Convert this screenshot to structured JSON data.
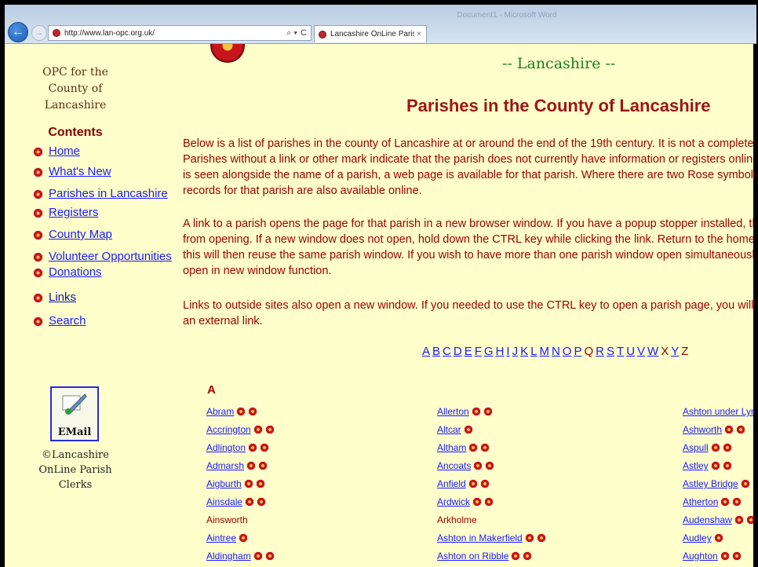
{
  "browser": {
    "window_title_ghost": "Document1 - Microsoft Word",
    "address": "http://www.lan-opc.org.uk/",
    "address_tools": [
      "⌕ ▾",
      "C"
    ],
    "tab_title": "Lancashire OnLine Parish Cl...",
    "tab_close": "×"
  },
  "sidebar": {
    "brand_lines": [
      "OPC for the",
      "County of",
      "Lancashire"
    ],
    "contents_heading": "Contents",
    "nav": [
      {
        "label": "Home"
      },
      {
        "label": "What's New"
      },
      {
        "label": "Parishes in Lancashire"
      },
      {
        "label": "Registers"
      },
      {
        "label": "County Map"
      },
      {
        "label": "Volunteer Opportunities"
      },
      {
        "label": "Donations"
      },
      {
        "label": "Links"
      },
      {
        "label": "Search"
      }
    ],
    "email_label": "EMail",
    "copyright_lines": [
      "©Lancashire",
      "OnLine Parish",
      "Clerks"
    ]
  },
  "main": {
    "county_title": "-- Lancashire --",
    "heading": "Parishes in the County of Lancashire",
    "paragraphs": [
      [
        "Below is a list of parishes in the county of Lancashire at or around the end of the 19th century. It is not a complete l",
        "Parishes without a link or other mark indicate that the parish does not currently have information or registers online.",
        "is seen alongside the name of a parish, a web page is available for that parish. Where there are two Rose symbols,",
        "records for that parish are also available online."
      ],
      [
        "A link to a parish opens the page for that parish in a new browser window. If you have a popup stopper installed, thi",
        "from opening. If a new window does not open, hold down the CTRL key while clicking the link. Return to the home v",
        "this will then reuse the same parish window. If you wish to have more than one parish window open simultaneously",
        "open in new window function."
      ],
      [
        "Links to outside sites also open a new window. If you needed to use the CTRL key to open a parish page, you will a",
        "an external link."
      ]
    ],
    "alphabet": [
      {
        "l": "A",
        "link": true
      },
      {
        "l": "B",
        "link": true
      },
      {
        "l": "C",
        "link": true
      },
      {
        "l": "D",
        "link": true
      },
      {
        "l": "E",
        "link": true
      },
      {
        "l": "F",
        "link": true
      },
      {
        "l": "G",
        "link": true
      },
      {
        "l": "H",
        "link": true
      },
      {
        "l": "I",
        "link": true
      },
      {
        "l": "J",
        "link": true
      },
      {
        "l": "K",
        "link": true
      },
      {
        "l": "L",
        "link": true
      },
      {
        "l": "M",
        "link": true
      },
      {
        "l": "N",
        "link": true
      },
      {
        "l": "O",
        "link": true
      },
      {
        "l": "P",
        "link": true
      },
      {
        "l": "Q",
        "link": false
      },
      {
        "l": "R",
        "link": true
      },
      {
        "l": "S",
        "link": true
      },
      {
        "l": "T",
        "link": true
      },
      {
        "l": "U",
        "link": true
      },
      {
        "l": "V",
        "link": true
      },
      {
        "l": "W",
        "link": true
      },
      {
        "l": "X",
        "link": false
      },
      {
        "l": "Y",
        "link": true
      },
      {
        "l": "Z",
        "link": false
      }
    ],
    "section_letter": "A",
    "columns": [
      [
        {
          "name": "Abram",
          "roses": 2,
          "link": true
        },
        {
          "name": "Accrington",
          "roses": 2,
          "link": true
        },
        {
          "name": "Adlington",
          "roses": 2,
          "link": true
        },
        {
          "name": "Admarsh",
          "roses": 2,
          "link": true
        },
        {
          "name": "Aigburth",
          "roses": 2,
          "link": true
        },
        {
          "name": "Ainsdale",
          "roses": 2,
          "link": true
        },
        {
          "name": "Ainsworth",
          "roses": 0,
          "link": false
        },
        {
          "name": "Aintree",
          "roses": 1,
          "link": true
        },
        {
          "name": "Aldingham",
          "roses": 2,
          "link": true
        }
      ],
      [
        {
          "name": "Allerton",
          "roses": 2,
          "link": true
        },
        {
          "name": "Altcar",
          "roses": 1,
          "link": true
        },
        {
          "name": "Altham",
          "roses": 2,
          "link": true
        },
        {
          "name": "Ancoats",
          "roses": 2,
          "link": true
        },
        {
          "name": "Anfield",
          "roses": 2,
          "link": true
        },
        {
          "name": "Ardwick",
          "roses": 2,
          "link": true
        },
        {
          "name": "Arkholme",
          "roses": 0,
          "link": false
        },
        {
          "name": "Ashton in Makerfield",
          "roses": 2,
          "link": true
        },
        {
          "name": "Ashton on Ribble",
          "roses": 2,
          "link": true
        }
      ],
      [
        {
          "name": "Ashton under Lyne",
          "roses": 0,
          "link": true
        },
        {
          "name": "Ashworth",
          "roses": 2,
          "link": true
        },
        {
          "name": "Aspull",
          "roses": 2,
          "link": true
        },
        {
          "name": "Astley",
          "roses": 2,
          "link": true
        },
        {
          "name": "Astley Bridge",
          "roses": 2,
          "link": true
        },
        {
          "name": "Atherton",
          "roses": 2,
          "link": true
        },
        {
          "name": "Audenshaw",
          "roses": 2,
          "link": true
        },
        {
          "name": "Audley",
          "roses": 1,
          "link": true
        },
        {
          "name": "Aughton",
          "roses": 2,
          "link": true
        }
      ]
    ]
  }
}
